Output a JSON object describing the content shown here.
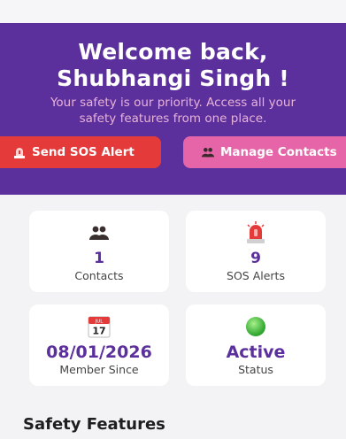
{
  "hero": {
    "title": "Welcome back,\nShubhangi Singh !",
    "subtitle": "Your safety is our priority. Access all your\nsafety features from one place.",
    "sos_button": {
      "label": "Send SOS Alert",
      "icon": "sos-siren-icon"
    },
    "contacts_button": {
      "label": "Manage Contacts",
      "icon": "people-icon"
    }
  },
  "stats": {
    "contacts": {
      "value": "1",
      "label": "Contacts",
      "icon": "people-icon"
    },
    "sos_alerts": {
      "value": "9",
      "label": "SOS Alerts",
      "icon": "siren-icon"
    },
    "member_since": {
      "value": "08/01/2026",
      "label": "Member Since",
      "icon": "calendar-icon",
      "calendar_month": "JUL",
      "calendar_day": "17"
    },
    "status": {
      "value": "Active",
      "label": "Status",
      "icon": "green-dot-icon"
    }
  },
  "sections": {
    "safety_features_title": "Safety Features"
  },
  "colors": {
    "primary": "#5b2f9c",
    "sos": "#e53a3a",
    "contacts": "#e665a8",
    "subtitle": "#e7b3d7",
    "active": "#3cbf3c"
  }
}
